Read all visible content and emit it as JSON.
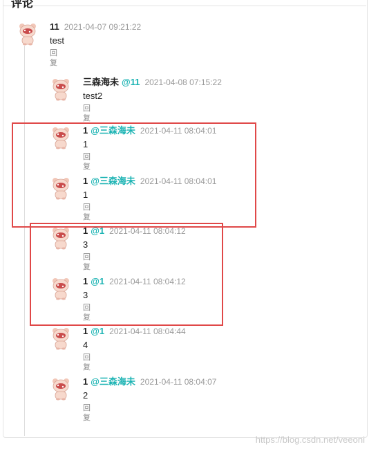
{
  "header": {
    "title": "评论"
  },
  "comments": [
    {
      "author": "11",
      "mention": "",
      "time": "2021-04-07 09:21:22",
      "content": "test",
      "reply": "回复"
    },
    {
      "author": "三森海未",
      "mention": "@11",
      "time": "2021-04-08 07:15:22",
      "content": "test2",
      "reply": "回复"
    },
    {
      "author": "1",
      "mention": "@三森海未",
      "time": "2021-04-11 08:04:01",
      "content": "1",
      "reply": "回复"
    },
    {
      "author": "1",
      "mention": "@三森海未",
      "time": "2021-04-11 08:04:01",
      "content": "1",
      "reply": "回复"
    },
    {
      "author": "1",
      "mention": "@1",
      "time": "2021-04-11 08:04:12",
      "content": "3",
      "reply": "回复"
    },
    {
      "author": "1",
      "mention": "@1",
      "time": "2021-04-11 08:04:12",
      "content": "3",
      "reply": "回复"
    },
    {
      "author": "1",
      "mention": "@1",
      "time": "2021-04-11 08:04:44",
      "content": "4",
      "reply": "回复"
    },
    {
      "author": "1",
      "mention": "@三森海未",
      "time": "2021-04-11 08:04:07",
      "content": "2",
      "reply": "回复"
    }
  ],
  "watermark": "https://blog.csdn.net/veeoni",
  "colors": {
    "mention": "#1bb3b3",
    "highlight": "#e04848",
    "time": "#9a9a9a"
  }
}
